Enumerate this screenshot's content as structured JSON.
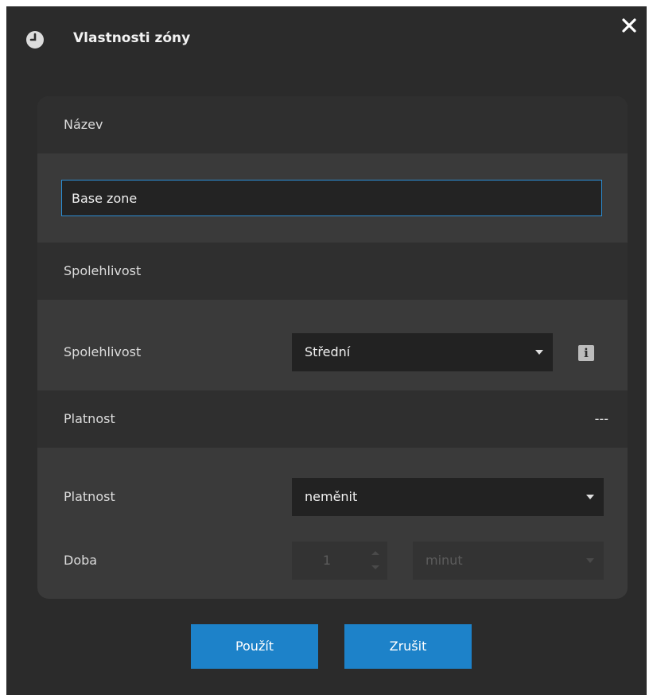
{
  "dialog": {
    "title": "Vlastnosti zóny",
    "icon": "clock-icon",
    "close_icon": "close-icon"
  },
  "name_section": {
    "header": "Název",
    "input_value": "Base zone"
  },
  "reliability_section": {
    "header": "Spolehlivost",
    "row_label": "Spolehlivost",
    "select_value": "Střední",
    "info_icon": "info-icon",
    "info_glyph": "i"
  },
  "validity_section": {
    "header": "Platnost",
    "header_value": "---",
    "validity_label": "Platnost",
    "validity_value": "neměnit",
    "duration_label": "Doba",
    "duration_value": "1",
    "duration_unit": "minut"
  },
  "buttons": {
    "apply": "Použít",
    "cancel": "Zrušit"
  },
  "colors": {
    "accent": "#1d82c9",
    "focus_border": "#2c8fd6",
    "background": "#2b2b2b",
    "panel": "#3a3a3a"
  }
}
